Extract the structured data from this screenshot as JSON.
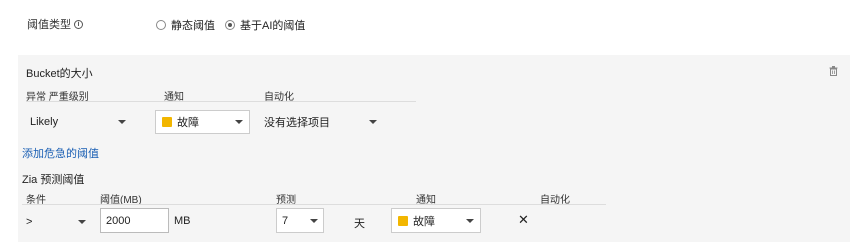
{
  "threshold_type": {
    "label": "阈值类型",
    "info_icon": "ⓘ",
    "options": [
      {
        "label": "静态阈值",
        "checked": false
      },
      {
        "label": "基于AI的阈值",
        "checked": true
      }
    ]
  },
  "bucket": {
    "title": "Bucket的大小",
    "columns": {
      "severity": "异常 严重级别",
      "notify": "通知",
      "automation": "自动化"
    },
    "row": {
      "severity": "Likely",
      "notify": "故障",
      "automation": "没有选择项目"
    },
    "status_color": "#f2b600"
  },
  "add_link": "添加危急的阈值",
  "zia": {
    "title": "Zia 预测阈值",
    "columns": {
      "condition": "条件",
      "threshold": "阈值(MB)",
      "predict": "预测",
      "notify": "通知",
      "automation": "自动化"
    },
    "row": {
      "condition": ">",
      "threshold_value": "2000",
      "threshold_unit": "MB",
      "predict_value": "7",
      "predict_unit": "天",
      "notify": "故障",
      "remove": "✕"
    }
  }
}
